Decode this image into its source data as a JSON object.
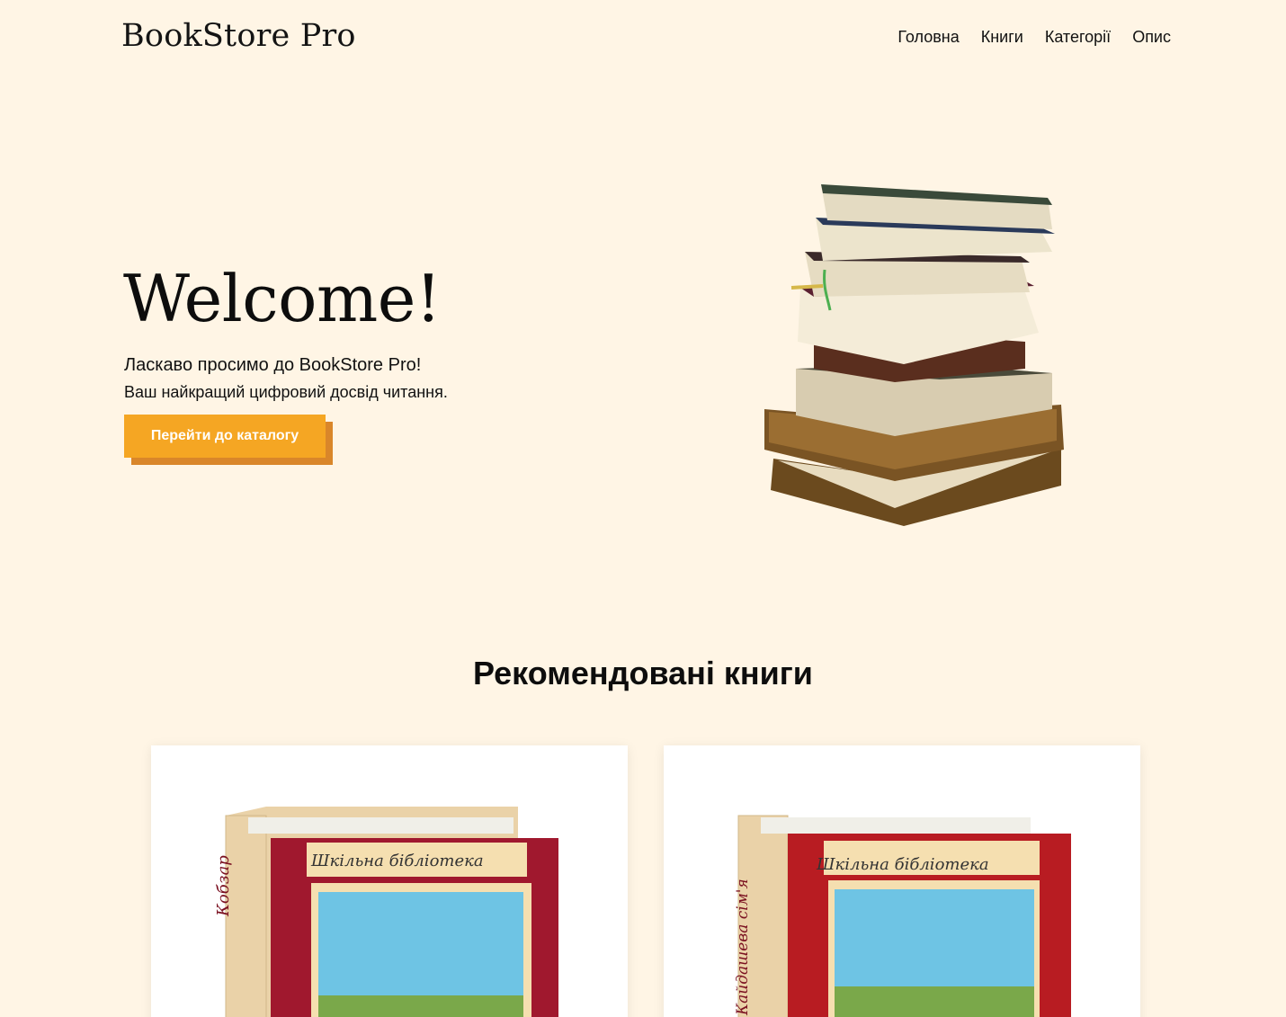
{
  "header": {
    "logo": "BookStore Pro",
    "nav": [
      "Головна",
      "Книги",
      "Категорії",
      "Опис"
    ]
  },
  "hero": {
    "title": "Welcome!",
    "subtitle1": "Ласкаво просимо до BookStore Pro!",
    "subtitle2": "Ваш найкращий цифровий досвід читання.",
    "cta_label": "Перейти до каталогу"
  },
  "featured": {
    "title": "Рекомендовані книги",
    "books": [
      {
        "series": "Шкільна бібліотека",
        "spine": "Кобзар",
        "cover_color": "#a0182e"
      },
      {
        "series": "Шкільна бібліотека",
        "spine": "Кайдашева сім'я",
        "cover_color": "#b81c22"
      }
    ]
  },
  "colors": {
    "background": "#fff5e5",
    "accent": "#f5a623",
    "accent_shadow": "#d9862a"
  }
}
